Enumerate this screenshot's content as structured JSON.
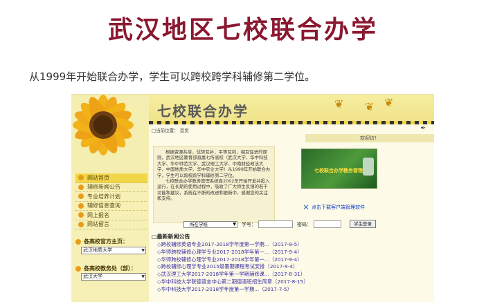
{
  "title": "武汉地区七校联合办学",
  "caption": "从1999年开始联合办学，学生可以跨校跨学科辅修第二学位。",
  "site": {
    "logo": "七校联合办学",
    "breadcrumb": "□当前位置： 首页",
    "welcome": "欢迎访！",
    "intro_p1": "根据资源共享，优势互补，平等互利，相互促进的原则，武汉地区教育部直属七所高校（武汉大学、华中科技大学、华中师范大学、武汉理工大学、中南财经政法大学、中国地质大学、华中农业大学）从1999年开始联合办学，学生可以跨校跨学科辅修第二学位。",
    "intro_p2": "七校联合办学教务管理系统自2002年开始开发并投入运行，在长期的使用过程中，吸收了广大师生反馈的若干功能和建议，系统在不断的改进和更新中，感谢您的关注和支持。",
    "green_panel_text": "七校联合办学教务管理系统",
    "download_link": "点击下载客户端管理软件",
    "menu": [
      {
        "label": "网站首页",
        "highlight": true
      },
      {
        "label": "辅修新闻公告",
        "highlight": false
      },
      {
        "label": "专业培养计划",
        "highlight": false
      },
      {
        "label": "辅修信息查询",
        "highlight": false
      },
      {
        "label": "网上报名",
        "highlight": false
      },
      {
        "label": "网站留言",
        "highlight": false
      }
    ],
    "section_home": "各高校官方主页：",
    "section_home_select": "武汉地质大学",
    "section_office": "各高校教务处（部）：",
    "section_office_select": "武汉大学",
    "search": {
      "school_select": "所在学校",
      "student_no_label": "学号：",
      "password_label": "密码：",
      "login_button": "学生登录"
    },
    "news_heading": "□最新新闻公告",
    "news": [
      "◇跨校辅修英语专业2017-2018学年度第一学期...（2017-9-5）",
      "◇华师跨校辅修心理学专业2017-2018学年第一...（2017-9-4）",
      "◇华师跨校辅修心理学专业2017-2018学年第一...（2017-9-4）",
      "◇跨校辅修心理学专业2015级暑期课程考试安排（2017-9-4）",
      "◇武汉理工大学2017-2018学年第一学期辅修课...（2017-8-31）",
      "◇华中科技大学联德语言中心第二期德语班招生简章（2017-8-15）",
      "◇华中科技大学2017-2018学年度第一学期...（2017-7-5）"
    ]
  }
}
